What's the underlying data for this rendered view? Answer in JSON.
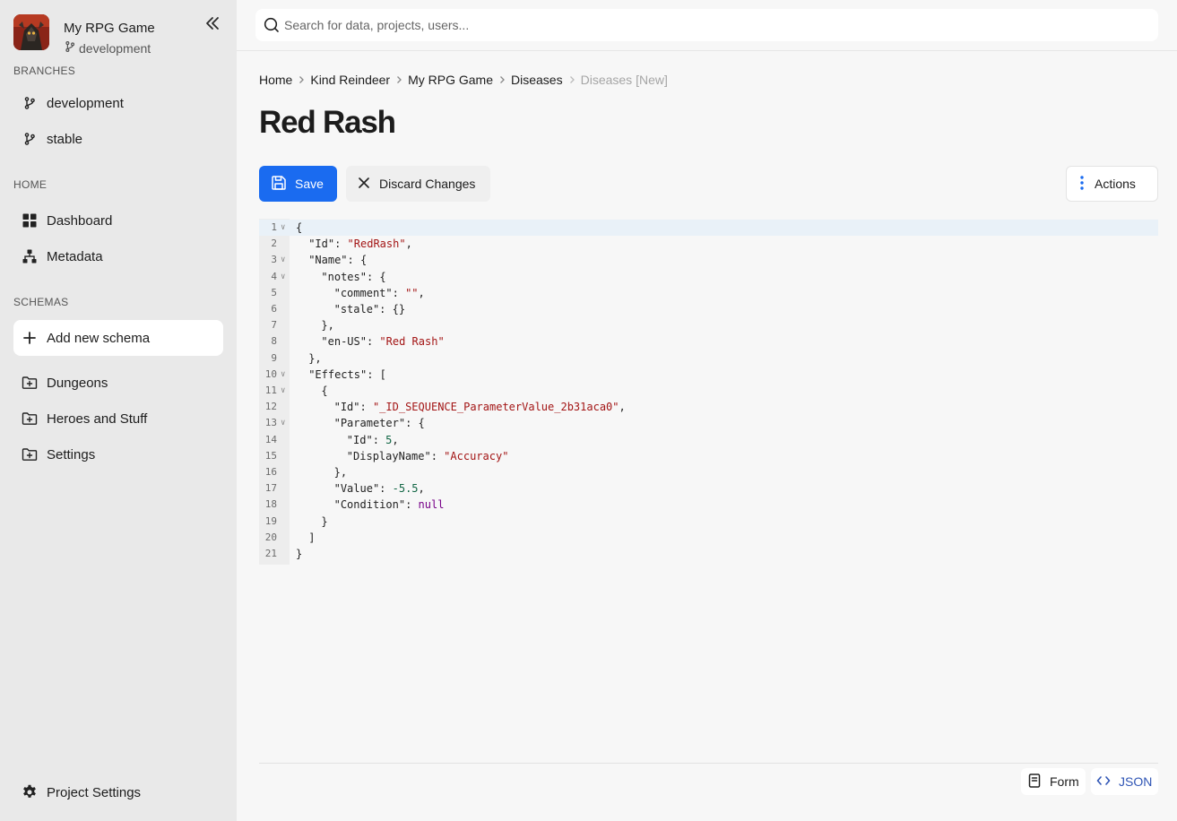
{
  "project": {
    "name": "My RPG Game",
    "branch": "development"
  },
  "sidebar": {
    "branches_heading": "BRANCHES",
    "branches": [
      {
        "label": "development",
        "icon": "git-branch-icon"
      },
      {
        "label": "stable",
        "icon": "git-branch-icon"
      }
    ],
    "home_heading": "HOME",
    "home_items": [
      {
        "label": "Dashboard",
        "icon": "dashboard-grid-icon"
      },
      {
        "label": "Metadata",
        "icon": "sitemap-icon"
      }
    ],
    "schemas_heading": "SCHEMAS",
    "add_schema_label": "Add new schema",
    "schemas": [
      {
        "label": "Dungeons",
        "icon": "folder-plus-icon"
      },
      {
        "label": "Heroes and Stuff",
        "icon": "folder-plus-icon"
      },
      {
        "label": "Settings",
        "icon": "folder-plus-icon"
      }
    ],
    "project_settings_label": "Project Settings"
  },
  "search": {
    "placeholder": "Search for data, projects, users..."
  },
  "breadcrumb": [
    "Home",
    "Kind Reindeer",
    "My RPG Game",
    "Diseases",
    "Diseases [New]"
  ],
  "page": {
    "title": "Red Rash"
  },
  "toolbar": {
    "save_label": "Save",
    "discard_label": "Discard Changes",
    "actions_label": "Actions"
  },
  "editor": {
    "lines": [
      {
        "n": "1",
        "fold": true,
        "indent": 0,
        "tokens": [
          [
            "p",
            "{"
          ]
        ]
      },
      {
        "n": "2",
        "fold": false,
        "indent": 1,
        "tokens": [
          [
            "p",
            "\"Id\": "
          ],
          [
            "s",
            "\"RedRash\""
          ],
          [
            "p",
            ","
          ]
        ]
      },
      {
        "n": "3",
        "fold": true,
        "indent": 1,
        "tokens": [
          [
            "p",
            "\"Name\": {"
          ]
        ]
      },
      {
        "n": "4",
        "fold": true,
        "indent": 2,
        "tokens": [
          [
            "p",
            "\"notes\": {"
          ]
        ]
      },
      {
        "n": "5",
        "fold": false,
        "indent": 3,
        "tokens": [
          [
            "p",
            "\"comment\": "
          ],
          [
            "s",
            "\"\""
          ],
          [
            "p",
            ","
          ]
        ]
      },
      {
        "n": "6",
        "fold": false,
        "indent": 3,
        "tokens": [
          [
            "p",
            "\"stale\": {}"
          ]
        ]
      },
      {
        "n": "7",
        "fold": false,
        "indent": 2,
        "tokens": [
          [
            "p",
            "},"
          ]
        ]
      },
      {
        "n": "8",
        "fold": false,
        "indent": 2,
        "tokens": [
          [
            "p",
            "\"en-US\": "
          ],
          [
            "s",
            "\"Red Rash\""
          ]
        ]
      },
      {
        "n": "9",
        "fold": false,
        "indent": 1,
        "tokens": [
          [
            "p",
            "},"
          ]
        ]
      },
      {
        "n": "10",
        "fold": true,
        "indent": 1,
        "tokens": [
          [
            "p",
            "\"Effects\": ["
          ]
        ]
      },
      {
        "n": "11",
        "fold": true,
        "indent": 2,
        "tokens": [
          [
            "p",
            "{"
          ]
        ]
      },
      {
        "n": "12",
        "fold": false,
        "indent": 3,
        "tokens": [
          [
            "p",
            "\"Id\": "
          ],
          [
            "s",
            "\"_ID_SEQUENCE_ParameterValue_2b31aca0\""
          ],
          [
            "p",
            ","
          ]
        ]
      },
      {
        "n": "13",
        "fold": true,
        "indent": 3,
        "tokens": [
          [
            "p",
            "\"Parameter\": {"
          ]
        ]
      },
      {
        "n": "14",
        "fold": false,
        "indent": 4,
        "tokens": [
          [
            "p",
            "\"Id\": "
          ],
          [
            "n",
            "5"
          ],
          [
            "p",
            ","
          ]
        ]
      },
      {
        "n": "15",
        "fold": false,
        "indent": 4,
        "tokens": [
          [
            "p",
            "\"DisplayName\": "
          ],
          [
            "s",
            "\"Accuracy\""
          ]
        ]
      },
      {
        "n": "16",
        "fold": false,
        "indent": 3,
        "tokens": [
          [
            "p",
            "},"
          ]
        ]
      },
      {
        "n": "17",
        "fold": false,
        "indent": 3,
        "tokens": [
          [
            "p",
            "\"Value\": "
          ],
          [
            "n",
            "-5.5"
          ],
          [
            "p",
            ","
          ]
        ]
      },
      {
        "n": "18",
        "fold": false,
        "indent": 3,
        "tokens": [
          [
            "p",
            "\"Condition\": "
          ],
          [
            "k",
            "null"
          ]
        ]
      },
      {
        "n": "19",
        "fold": false,
        "indent": 2,
        "tokens": [
          [
            "p",
            "}"
          ]
        ]
      },
      {
        "n": "20",
        "fold": false,
        "indent": 1,
        "tokens": [
          [
            "p",
            "]"
          ]
        ]
      },
      {
        "n": "21",
        "fold": false,
        "indent": 0,
        "tokens": [
          [
            "p",
            "}"
          ]
        ]
      }
    ]
  },
  "view_switch": {
    "form_label": "Form",
    "json_label": "JSON",
    "active": "JSON"
  },
  "colors": {
    "accent": "#1a6bf0",
    "json_active": "#2f55b5",
    "string": "#a31515",
    "number": "#116644",
    "keyword": "#770088"
  }
}
